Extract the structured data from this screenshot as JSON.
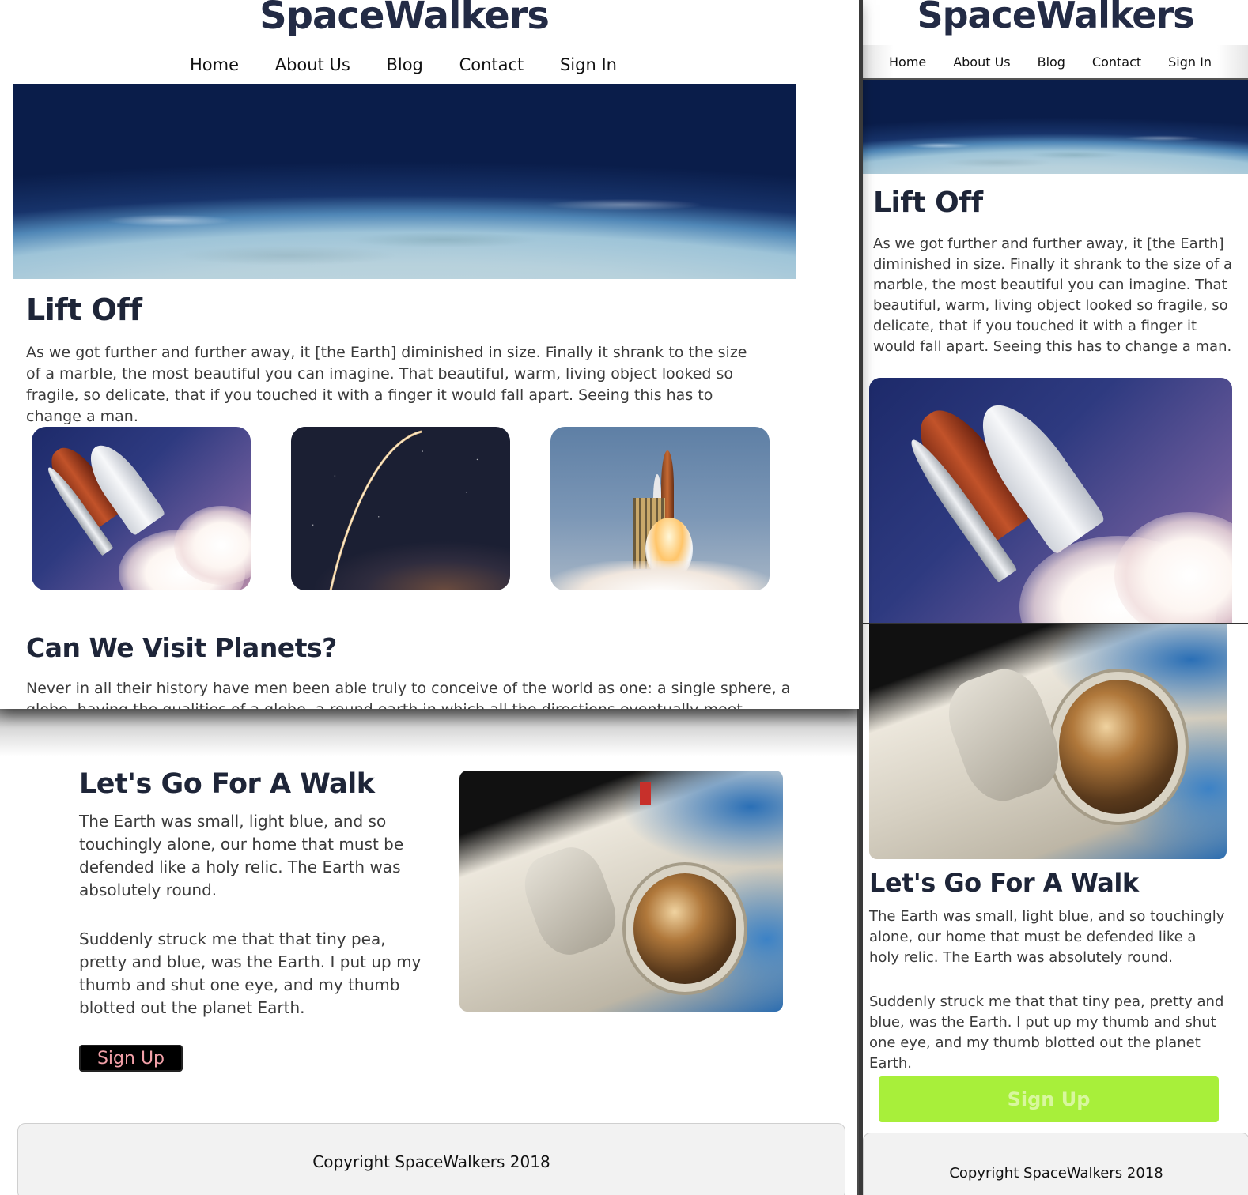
{
  "brand": "SpaceWalkers",
  "nav": [
    "Home",
    "About Us",
    "Blog",
    "Contact",
    "Sign In"
  ],
  "lift_off": {
    "title": "Lift Off",
    "text": "As we got further and further away, it [the Earth] diminished in size. Finally it shrank to the size of a marble, the most beautiful you can imagine. That beautiful, warm, living object looked so fragile, so delicate, that if you touched it with a finger it would fall apart. Seeing this has to change a man."
  },
  "planets": {
    "title": "Can We Visit Planets?",
    "text": "Never in all their history have men been able truly to conceive of the world as one: a single sphere, a",
    "text_cut": "globe, having the qualities of a globe, a round earth in which all the directions eventually meet"
  },
  "walk": {
    "title": "Let's Go For A Walk",
    "para1": "The Earth was small, light blue, and so touchingly alone, our home that must be defended like a holy relic. The Earth was absolutely round.",
    "para2": "Suddenly struck me that that tiny pea, pretty and blue, was the Earth. I put up my thumb and shut one eye, and my thumb blotted out the planet Earth."
  },
  "signup_label": "Sign Up",
  "footer": "Copyright SpaceWalkers 2018",
  "colors": {
    "heading": "#1e2538",
    "signup_dark_bg": "#000000",
    "signup_dark_text": "#f2a0a8",
    "signup_green_bg": "#a8ef3a"
  },
  "icons": [
    "earth-horizon-image",
    "shuttle-image",
    "launch-arc-image",
    "launch-pad-image",
    "astronaut-image"
  ]
}
